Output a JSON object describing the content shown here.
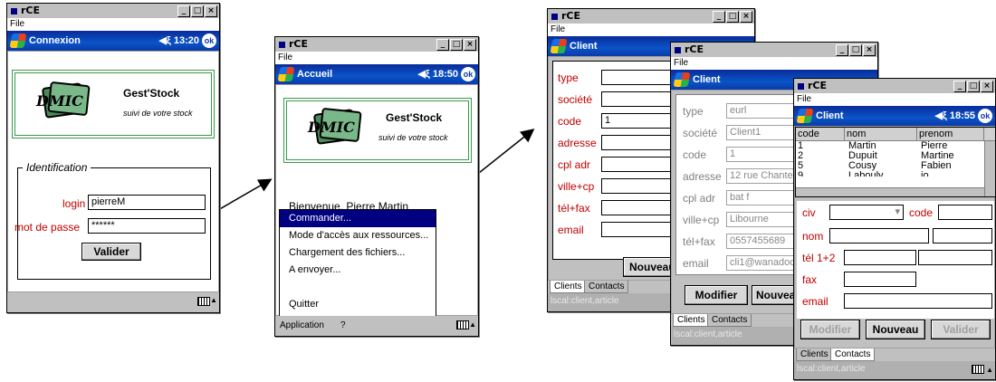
{
  "app_title": "rCE",
  "menu_file": "File",
  "screen1": {
    "title": "Connexion",
    "time": "13:20",
    "ok": "ok",
    "logo_text": "DMIC",
    "logo_title": "Gest'Stock",
    "logo_sub": "suivi de votre stock",
    "group_title": "Identification",
    "login_label": "login",
    "login_value": "pierreM",
    "password_label": "mot de passe",
    "password_value": "******",
    "submit": "Valider"
  },
  "screen2": {
    "title": "Accueil",
    "time": "18:50",
    "ok": "ok",
    "logo_text": "DMIC",
    "logo_title": "Gest'Stock",
    "logo_sub": "suivi de votre stock",
    "welcome": "Bienvenue, Pierre Martin",
    "menu_items": [
      "Commander...",
      "Mode d'accès aux ressources...",
      "Chargement des fichiers...",
      "A envoyer...",
      "",
      "Quitter"
    ],
    "bottom_app": "Application",
    "bottom_help": "?"
  },
  "screen3": {
    "title": "Client",
    "labels": [
      "type",
      "société",
      "code",
      "adresse",
      "cpl adr",
      "ville+cp",
      "tél+fax",
      "email"
    ],
    "code_value": "1",
    "nouveau": "Nouveau",
    "tabs": [
      "Clients",
      "Contacts"
    ],
    "status": "lscal:client,article"
  },
  "screen4": {
    "title": "Client",
    "labels": [
      "type",
      "société",
      "code",
      "adresse",
      "cpl adr",
      "ville+cp",
      "tél+fax",
      "email"
    ],
    "values": [
      "eurl",
      "Client1",
      "1",
      "12 rue Chante",
      "bat f",
      "Libourne",
      "0557455689",
      "cli1@wanadoo"
    ],
    "modifier": "Modifier",
    "nouveau": "Nouvea",
    "tabs": [
      "Clients",
      "Contacts"
    ],
    "status": "lscal:client,article"
  },
  "screen5": {
    "title": "Client",
    "time": "18:55",
    "ok": "ok",
    "columns": [
      "code",
      "nom",
      "prenom"
    ],
    "rows": [
      [
        "1",
        "Martin",
        "Pierre"
      ],
      [
        "2",
        "Dupuit",
        "Martine"
      ],
      [
        "5",
        "Cousy",
        "Fabien"
      ],
      [
        "9",
        "Labouly",
        "jo"
      ]
    ],
    "civ_label": "civ",
    "code_label": "code",
    "nom_label": "nom",
    "tel_label": "tél 1+2",
    "fax_label": "fax",
    "email_label": "email",
    "modifier": "Modifier",
    "nouveau": "Nouveau",
    "valider": "Valider",
    "tabs": [
      "Clients",
      "Contacts"
    ],
    "status": "lscal:client,article"
  }
}
